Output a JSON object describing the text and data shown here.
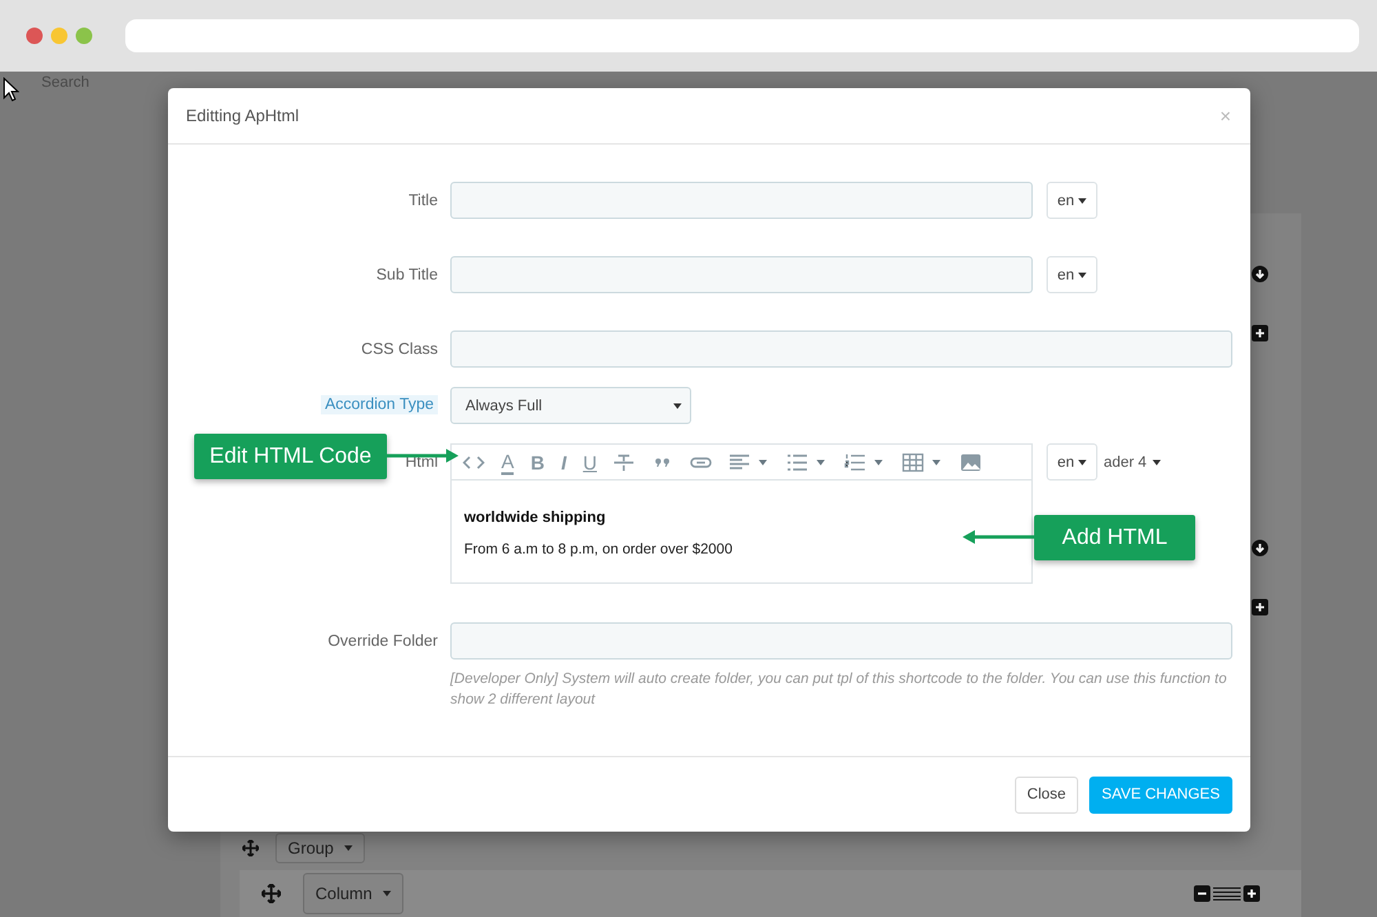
{
  "background": {
    "search_label": "Search",
    "group_button": "Group",
    "column_button": "Column"
  },
  "modal": {
    "title": "Editting ApHtml",
    "close": "×",
    "fields": [
      {
        "kind": "text",
        "label": "Title",
        "lang": "en",
        "highlighted": false
      },
      {
        "kind": "text",
        "label": "Sub Title",
        "lang": "en",
        "highlighted": false
      },
      {
        "kind": "text",
        "label": "CSS Class",
        "highlighted": false
      },
      {
        "kind": "select",
        "label": "Accordion Type",
        "value": "Always Full",
        "highlighted": true
      },
      {
        "kind": "editor",
        "label": "Html",
        "lang": "en",
        "highlighted": false,
        "toolbar": [
          {
            "kind": "code"
          },
          {
            "kind": "color",
            "label": "A"
          },
          {
            "kind": "bold",
            "label": "B"
          },
          {
            "kind": "italic",
            "label": "I"
          },
          {
            "kind": "underline",
            "label": "U"
          },
          {
            "kind": "strike"
          },
          {
            "kind": "quote"
          },
          {
            "kind": "link"
          },
          {
            "kind": "align"
          },
          {
            "kind": "ul"
          },
          {
            "kind": "ol"
          },
          {
            "kind": "table"
          },
          {
            "kind": "image"
          }
        ],
        "heading_menu": "ader 4",
        "content_heading": "worldwide shipping",
        "content_text": "From 6 a.m to 8 p.m, on order over $2000"
      },
      {
        "kind": "text",
        "label": "Override Folder",
        "highlighted": false,
        "help": "[Developer Only] System will auto create folder, you can put tpl of this shortcode to the folder. You can use this function to show 2 different layout"
      }
    ],
    "buttons": [
      {
        "label": "Close",
        "kind": "default"
      },
      {
        "label": "SAVE CHANGES",
        "kind": "primary"
      }
    ]
  },
  "callouts": [
    {
      "text": "Edit HTML Code",
      "kind": "right"
    },
    {
      "text": "Add HTML",
      "kind": "left"
    }
  ]
}
